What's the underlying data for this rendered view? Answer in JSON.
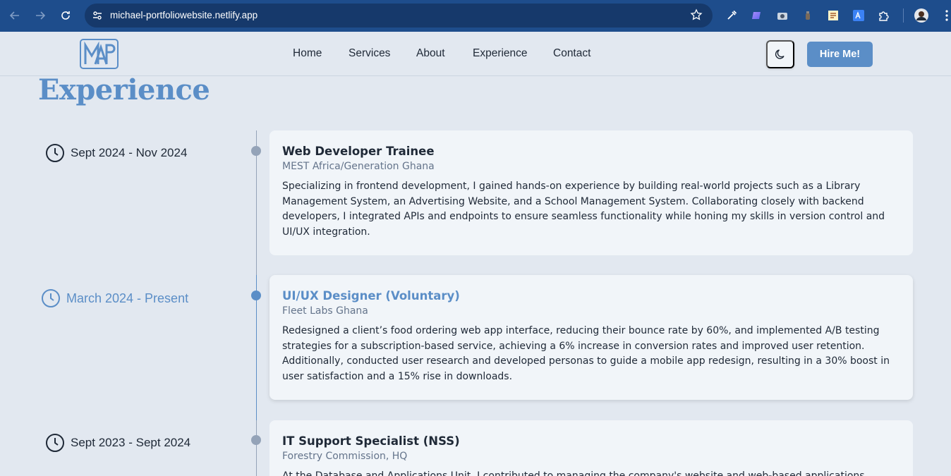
{
  "browser": {
    "url": "michael-portfoliowebsite.netlify.app",
    "icons": [
      "back-icon",
      "forward-icon",
      "reload-icon",
      "site-info-icon",
      "bookmark-star-icon",
      "eyedropper-extension-icon",
      "gradient-extension-icon",
      "camera-extension-icon",
      "bottle-extension-icon",
      "notes-extension-icon",
      "translate-extension-icon",
      "extensions-puzzle-icon",
      "profile-avatar-icon",
      "menu-dots-icon"
    ]
  },
  "header": {
    "logo_text": "MAP",
    "nav": [
      "Home",
      "Services",
      "About",
      "Experience",
      "Contact"
    ],
    "theme_icon": "moon-icon",
    "hire_label": "Hire Me!"
  },
  "section": {
    "title": "Experience"
  },
  "experience": [
    {
      "date": "Sept 2024 - Nov 2024",
      "title": "Web Developer Trainee",
      "org": "MEST Africa/Generation Ghana",
      "description": "Specializing in frontend development, I gained hands-on experience by building real-world projects such as a Library Management System, an Advertising Website, and a School Management System. Collaborating closely with backend developers, I integrated APIs and endpoints to ensure seamless functionality while honing my skills in version control and UI/UX integration.",
      "active": false
    },
    {
      "date": "March 2024 - Present",
      "title": "UI/UX Designer (Voluntary)",
      "org": "Fleet Labs Ghana",
      "description": "Redesigned a client’s food ordering web app interface, reducing their bounce rate by 60%, and implemented A/B testing strategies for a subscription-based service, achieving a 6% increase in conversion rates and improved user retention. Additionally, conducted user research and developed personas to guide a mobile app redesign, resulting in a 30% boost in user satisfaction and a 15% rise in downloads.",
      "active": true
    },
    {
      "date": "Sept 2023 - Sept 2024",
      "title": "IT Support Specialist (NSS)",
      "org": "Forestry Commission, HQ",
      "description": "At the Database and Applications Unit, I contributed to managing the company's website and web-based applications",
      "active": false
    }
  ],
  "colors": {
    "accent": "#5b8ec7",
    "chrome": "#1e4d8c",
    "background": "#e2e8f0",
    "card": "#f1f5f9",
    "muted": "#94a3b8"
  }
}
